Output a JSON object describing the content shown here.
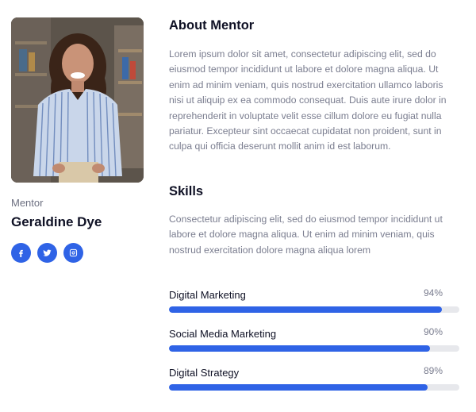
{
  "mentor": {
    "role": "Mentor",
    "name": "Geraldine Dye",
    "socials": [
      {
        "icon": "facebook-icon"
      },
      {
        "icon": "twitter-icon"
      },
      {
        "icon": "instagram-icon"
      }
    ]
  },
  "about": {
    "heading": "About Mentor",
    "text": "Lorem ipsum dolor sit amet, consectetur adipiscing elit, sed do eiusmod tempor incididunt ut labore et dolore magna aliqua. Ut enim ad minim veniam, quis nostrud exercitation ullamco laboris nisi ut aliquip ex ea commodo consequat. Duis aute irure dolor in reprehenderit in voluptate velit esse cillum dolore eu fugiat nulla pariatur. Excepteur sint occaecat cupidatat non proident, sunt in culpa qui officia deserunt mollit anim id est laborum."
  },
  "skills": {
    "heading": "Skills",
    "text": "Consectetur adipiscing elit, sed do eiusmod tempor incididunt ut labore et dolore magna aliqua. Ut enim ad minim veniam, quis nostrud exercitation dolore magna aliqua lorem",
    "items": [
      {
        "label": "Digital Marketing",
        "percent": "94%",
        "value": 94
      },
      {
        "label": "Social Media Marketing",
        "percent": "90%",
        "value": 90
      },
      {
        "label": "Digital Strategy",
        "percent": "89%",
        "value": 89
      }
    ]
  },
  "colors": {
    "accent": "#2f63e6",
    "track": "#e7e8ec",
    "heading": "#0f1125",
    "body": "#7a7d8f"
  }
}
